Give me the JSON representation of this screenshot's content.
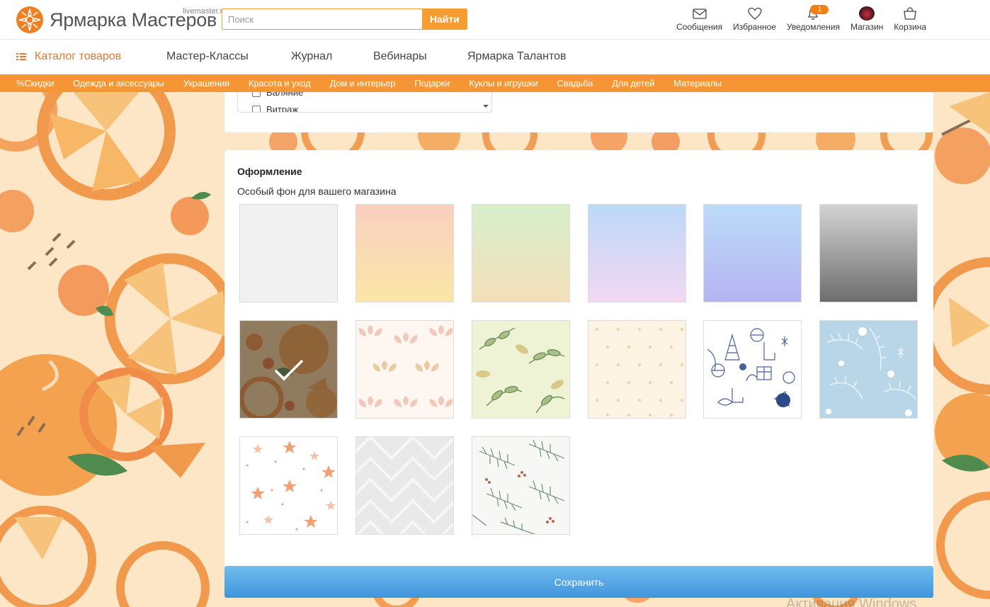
{
  "header": {
    "logo_text": "Ярмарка Мастеров",
    "logo_sub": "livemaster.ru",
    "search_placeholder": "Поиск",
    "search_button": "Найти",
    "icons": [
      {
        "name": "messages-icon",
        "label": "Сообщения"
      },
      {
        "name": "heart-icon",
        "label": "Избранное"
      },
      {
        "name": "bell-icon",
        "label": "Уведомления",
        "badge": "1"
      },
      {
        "name": "shop-avatar",
        "label": "Магазин"
      },
      {
        "name": "cart-icon",
        "label": "Корзина"
      }
    ]
  },
  "main_nav": {
    "catalog": "Каталог товаров",
    "items": [
      "Мастер-Классы",
      "Журнал",
      "Вебинары",
      "Ярмарка Талантов"
    ]
  },
  "categories": [
    "%Скидки",
    "Одежда и аксессуары",
    "Украшения",
    "Красота и уход",
    "Дом и интерьер",
    "Подарки",
    "Куклы и игрушки",
    "Свадьба",
    "Для детей",
    "Материалы"
  ],
  "checklist": {
    "items": [
      "Валяние",
      "Витраж"
    ]
  },
  "design": {
    "title": "Оформление",
    "subtitle": "Особый фон для вашего магазина",
    "selected_index": 6,
    "backgrounds": [
      {
        "name": "plain-light-gray",
        "colors": [
          "#f1f1f1"
        ]
      },
      {
        "name": "gradient-peach-yellow",
        "colors": [
          "#f9cfc0",
          "#fbe7a6"
        ]
      },
      {
        "name": "gradient-green-beige",
        "colors": [
          "#d9efcc",
          "#f3dfb9"
        ]
      },
      {
        "name": "gradient-blue-pink",
        "colors": [
          "#bcd8f8",
          "#f3d8f3"
        ]
      },
      {
        "name": "gradient-blue-violet",
        "colors": [
          "#bcdcf8",
          "#b4b4f2"
        ]
      },
      {
        "name": "gradient-gray-dark",
        "colors": [
          "#d4d4d4",
          "#6c6c6c"
        ]
      },
      {
        "name": "pattern-oranges"
      },
      {
        "name": "pattern-leaves-pastel"
      },
      {
        "name": "pattern-green-leaves"
      },
      {
        "name": "pattern-dots-cream"
      },
      {
        "name": "pattern-christmas-doodles"
      },
      {
        "name": "pattern-snowy-branches"
      },
      {
        "name": "pattern-stars"
      },
      {
        "name": "pattern-gray-geometric"
      },
      {
        "name": "pattern-pine-branches"
      }
    ]
  },
  "save_button": "Сохранить",
  "watermark": "Активация Windows",
  "colors": {
    "accent": "#f69533",
    "catalog": "#e8762a",
    "save_button": "#4fa3e3"
  }
}
